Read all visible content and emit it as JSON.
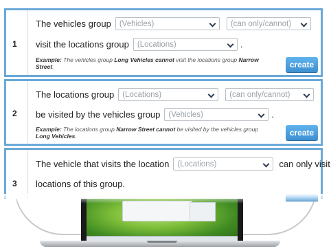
{
  "rules": [
    {
      "number": "1",
      "line1_text": "The vehicles group",
      "select1": "(Vehicles)",
      "select2": "(can only/cannot)",
      "line2_text": "visit the locations group",
      "select3": "(Locations)",
      "line2_end": ".",
      "example_label": "Example:",
      "example_a": " The vehicles group ",
      "example_b": "Long Vehicles cannot",
      "example_c": " visit the locations group ",
      "example_d": "Narrow Street",
      "example_e": ".",
      "button": "create"
    },
    {
      "number": "2",
      "line1_text": "The locations group",
      "select1": "(Locations)",
      "select2": "(can only/cannot)",
      "line2_text": "be visited by the vehicles group",
      "select3": "(Vehicles)",
      "line2_end": ".",
      "example_label": "Example:",
      "example_a": " The locations group ",
      "example_b": "Narrow Street cannot",
      "example_c": " be visited by the vehicles group ",
      "example_d": "Long Vehicles",
      "example_e": ".",
      "button": "create"
    },
    {
      "number": "3",
      "line1_text": "The vehicle that visits the location",
      "select1": "(Locations)",
      "line1_end": "can only visit",
      "line2_text": "locations of this group."
    }
  ],
  "icons": [
    "chevron-down-icon"
  ]
}
